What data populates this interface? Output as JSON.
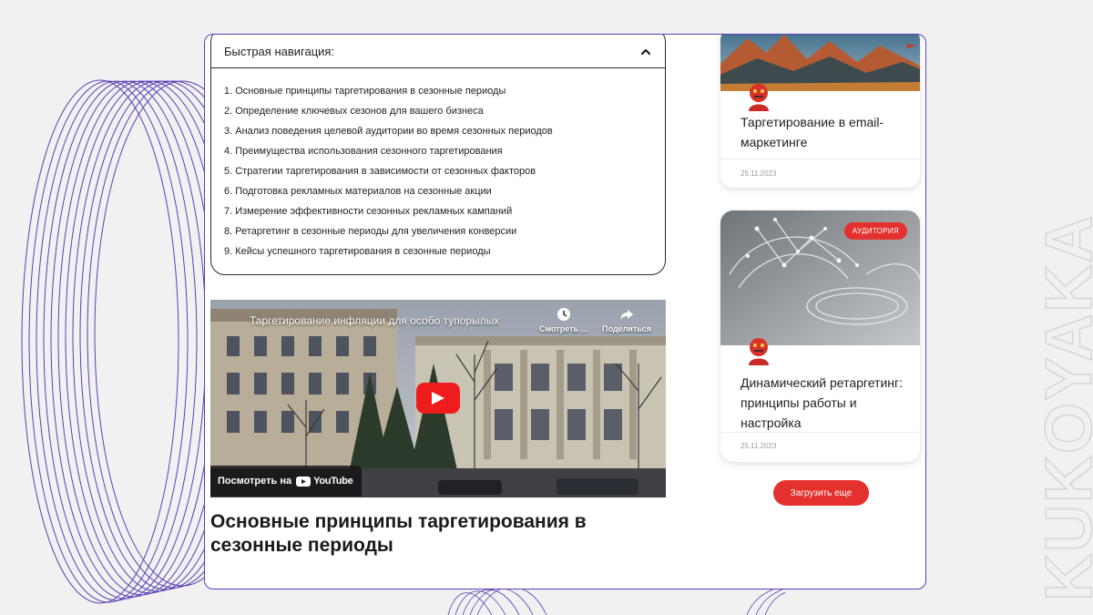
{
  "brand": {
    "vertical_text": "KUKOYAKA",
    "stroke_color": "#d7d7d7"
  },
  "colors": {
    "frame_border": "#5b3fb5",
    "accent_red": "#e5312e",
    "deco_purple": "#5b3fb5"
  },
  "quick_nav": {
    "title": "Быстрая навигация:",
    "toggle_icon": "chevron-up-icon",
    "items": [
      {
        "label": "1.  Основные принципы таргетирования в сезонные периоды"
      },
      {
        "label": "2.  Определение ключевых сезонов для вашего бизнеса"
      },
      {
        "label": "3.  Анализ поведения целевой аудитории во время сезонных периодов"
      },
      {
        "label": "4.  Преимущества использования сезонного таргетирования"
      },
      {
        "label": "5.  Стратегии таргетирования в зависимости от сезонных факторов"
      },
      {
        "label": "6.  Подготовка рекламных материалов на сезонные акции"
      },
      {
        "label": "7.  Измерение эффективности сезонных рекламных кампаний"
      },
      {
        "label": "8.  Ретаргетинг в сезонные периоды для увеличения конверсии"
      },
      {
        "label": "9.  Кейсы успешного таргетирования в сезонные периоды"
      }
    ]
  },
  "video": {
    "title": "Таргетирование инфляции для особо тупорылых",
    "watch_later_label": "Смотреть ...",
    "share_label": "Поделиться",
    "watch_on_label": "Посмотреть на",
    "youtube_label": "YouTube"
  },
  "article": {
    "heading": "Основные принципы таргетирования в сезонные периоды"
  },
  "sidebar": {
    "cards": [
      {
        "title": "Таргетирование в email-маркетинге",
        "date": "25.11.2023",
        "tag": ""
      },
      {
        "title": "Динамический ретаргетинг: принципы работы и настройка",
        "date": "25.11.2023",
        "tag": "АУДИТОРИЯ"
      }
    ],
    "load_more_label": "Загрузить еще"
  }
}
